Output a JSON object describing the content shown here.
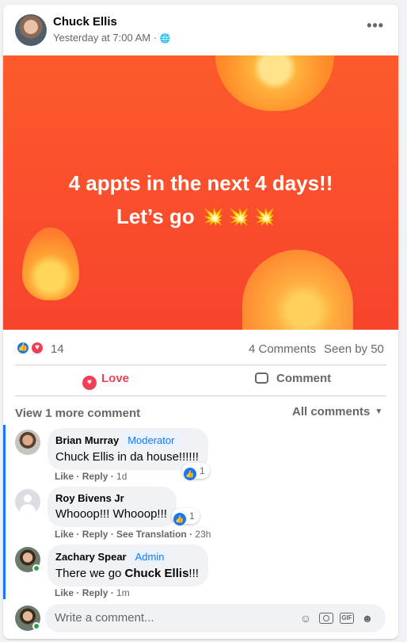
{
  "post": {
    "author": "Chuck Ellis",
    "time": "Yesterday at 7:00 AM · ",
    "privacy_icon": "globe-icon",
    "more_label": "•••",
    "image_text_line1": "4 appts in the next 4 days!!",
    "image_text_line2": "Let’s go 💥💥💥",
    "image_bg_color": "#f84a2c"
  },
  "stats": {
    "reaction_count": "14",
    "comments": "4 Comments",
    "seen_by": "Seen by 50"
  },
  "actions": {
    "love_label": "Love",
    "comment_label": "Comment",
    "love_color": "#f33e58"
  },
  "comments_header": {
    "view_more": "View 1 more comment",
    "filter": "All comments"
  },
  "comments": [
    {
      "author": "Brian Murray",
      "badge": "Moderator",
      "text": "Chuck Ellis in da house!!!!!!",
      "like": "Like",
      "reply": "Reply",
      "time": "1d",
      "reactions": "1"
    },
    {
      "author": "Roy Bivens Jr",
      "text": "Whooop!!! Whooop!!!",
      "like": "Like",
      "reply": "Reply",
      "translate": "See Translation",
      "time": "23h",
      "reactions": "1"
    },
    {
      "author": "Zachary Spear",
      "badge": "Admin",
      "text_prefix": "There we go ",
      "text_bold": "Chuck Ellis",
      "text_suffix": "!!!",
      "like": "Like",
      "reply": "Reply",
      "time": "1m"
    }
  ],
  "composer": {
    "placeholder": "Write a comment...",
    "icons": [
      "emoji-icon",
      "camera-icon",
      "gif-icon",
      "sticker-icon"
    ]
  },
  "colors": {
    "accent": "#1877f2",
    "online": "#31a24c"
  }
}
